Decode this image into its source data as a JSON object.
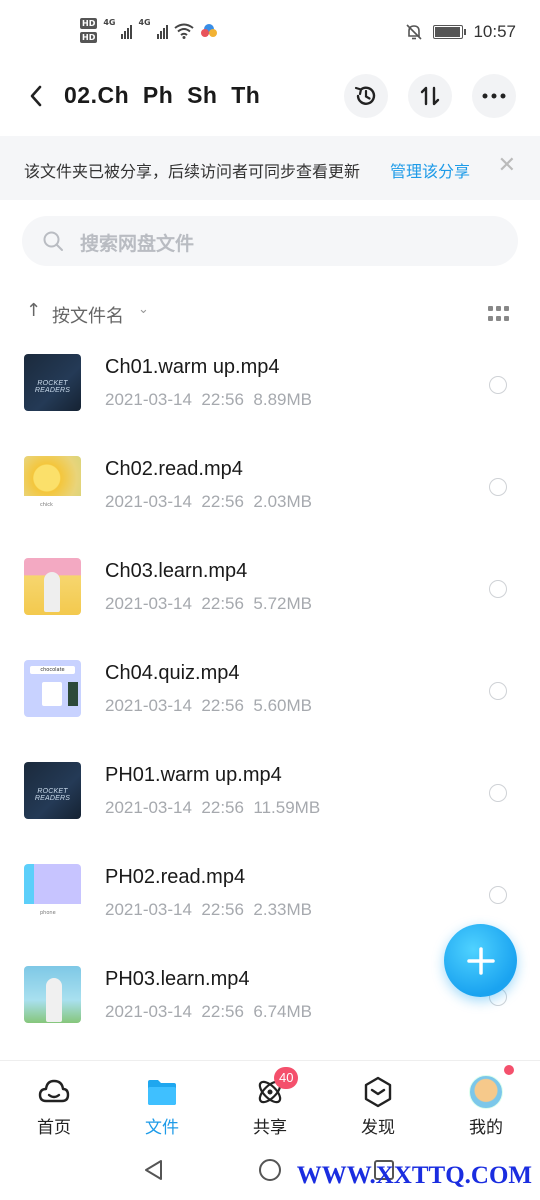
{
  "status_bar": {
    "time": "10:57",
    "hd_labels": [
      "HD",
      "HD"
    ],
    "network_labels": [
      "4G",
      "4G"
    ],
    "battery_level": 0.88,
    "icons": [
      "wifi-icon",
      "cloud-app-icon",
      "mute-icon",
      "battery-icon"
    ]
  },
  "header": {
    "title": "02.Ch  Ph  Sh  Th",
    "icons": [
      "back-arrow-icon",
      "history-icon",
      "transfer-icon",
      "more-icon"
    ]
  },
  "banner": {
    "text": "该文件夹已被分享，后续访问者可同步查看更新",
    "link": "管理该分享",
    "close": "✕"
  },
  "search": {
    "placeholder": "搜索网盘文件"
  },
  "sort": {
    "arrow": "↑",
    "label": "按文件名",
    "chevron": "⌄"
  },
  "files": [
    {
      "name": "Ch01.warm up.mp4",
      "meta": "2021-03-14  22:56  8.89MB",
      "thumb_text": "ROCKET READERS"
    },
    {
      "name": "Ch02.read.mp4",
      "meta": "2021-03-14  22:56  2.03MB",
      "thumb_text": "chick"
    },
    {
      "name": "Ch03.learn.mp4",
      "meta": "2021-03-14  22:56  5.72MB",
      "thumb_text": ""
    },
    {
      "name": "Ch04.quiz.mp4",
      "meta": "2021-03-14  22:56  5.60MB",
      "thumb_text": "chocolate"
    },
    {
      "name": "PH01.warm up.mp4",
      "meta": "2021-03-14  22:56  11.59MB",
      "thumb_text": "ROCKET READERS"
    },
    {
      "name": "PH02.read.mp4",
      "meta": "2021-03-14  22:56  2.33MB",
      "thumb_text": "phone"
    },
    {
      "name": "PH03.learn.mp4",
      "meta": "2021-03-14  22:56  6.74MB",
      "thumb_text": ""
    }
  ],
  "fab": {
    "icon": "plus-icon"
  },
  "bottom_nav": [
    {
      "label": "首页",
      "icon": "home-cloud-icon",
      "active": false
    },
    {
      "label": "文件",
      "icon": "folder-icon",
      "active": true
    },
    {
      "label": "共享",
      "icon": "share-atom-icon",
      "active": false,
      "badge": "40"
    },
    {
      "label": "发现",
      "icon": "discover-cube-icon",
      "active": false
    },
    {
      "label": "我的",
      "icon": "avatar-icon",
      "active": false
    }
  ],
  "system_nav": {
    "icons": [
      "back-triangle-icon",
      "home-circle-icon",
      "recents-square-icon"
    ]
  },
  "watermark": "WWW.XXTTQ.COM",
  "colors": {
    "accent": "#1e9be8",
    "badge": "#f4506c",
    "meta_text": "#a6a9ae"
  }
}
